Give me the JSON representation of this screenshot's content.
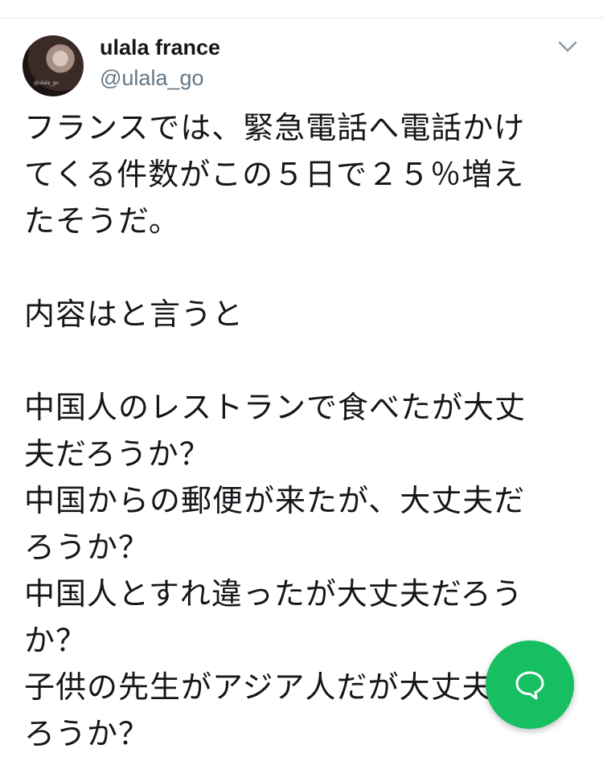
{
  "tweet": {
    "display_name": "ulala france",
    "handle": "@ulala_go",
    "avatar_watermark": "@ulala_go",
    "text_lines": [
      "フランスでは、緊急電話へ電話かけ",
      "てくる件数がこの５日で２５％増え",
      "たそうだ。",
      "",
      "内容はと言うと",
      "",
      "中国人のレストランで食べたが大丈",
      "夫だろうか？",
      "中国からの郵便が来たが、大丈夫だ",
      "ろうか？",
      "中国人とすれ違ったが大丈夫だろう",
      "か？",
      "子供の先生がアジア人だが大丈夫だ",
      "ろうか？"
    ]
  },
  "icons": {
    "caret": "chevron-down-icon",
    "fab": "reply-bubble-icon"
  },
  "colors": {
    "text": "#14171a",
    "secondary": "#657786",
    "fab": "#17bf63",
    "divider": "#e1e8ed"
  }
}
